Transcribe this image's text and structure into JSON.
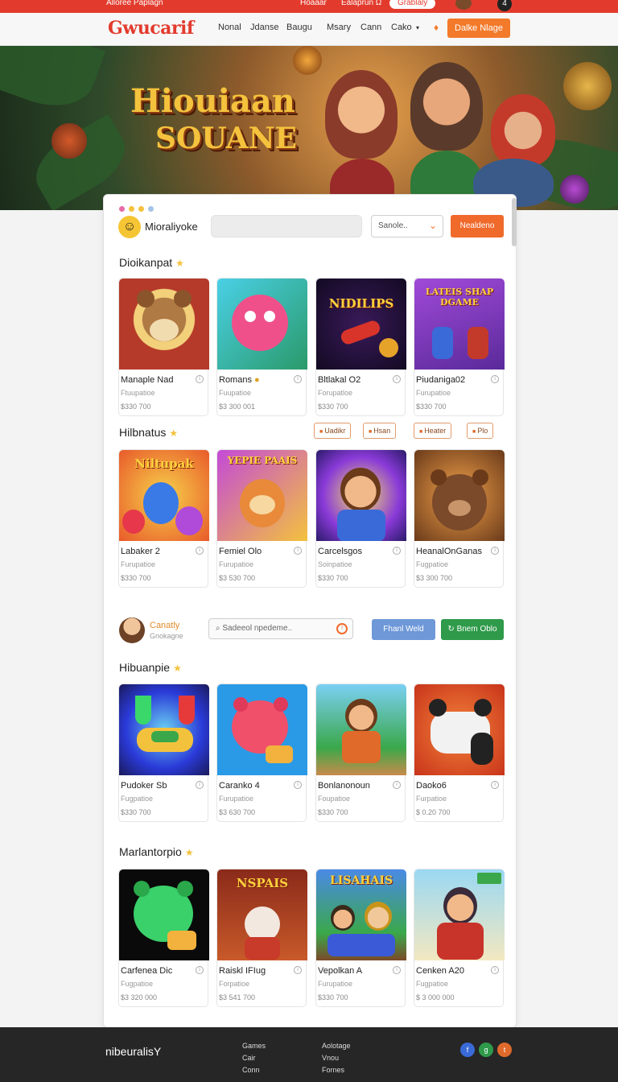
{
  "topbar": {
    "left_text": "Alloree Paplagn",
    "mid1": "Hoaaar",
    "mid2": "Ealaprun Ω",
    "pill": "Grablaly",
    "bell": "4"
  },
  "nav": {
    "logo": "Gwucarif",
    "links": [
      "Nonal",
      "Jdanse",
      "Baugu",
      "Msary",
      "Cann",
      "Cako"
    ],
    "cta": "Dalke Nlage",
    "colors": {
      "brand": "#e23b2d",
      "accent": "#f37a2b"
    }
  },
  "hero": {
    "title": "Hiouiaan",
    "subtitle": "SOUANE"
  },
  "panel": {
    "user_name": "Mioraliyoke",
    "select_value": "Sanole..",
    "button": "Nealdeno",
    "sections": [
      {
        "title": "Dioikanpat",
        "cards": [
          {
            "name": "Manaple Nad",
            "sub": "Ftuupatioe",
            "price": "$330 700",
            "thumb": "ABCDEF"
          },
          {
            "name": "Romans",
            "sub": "Fuupatioe",
            "price": "$3 300 001",
            "thumb": ""
          },
          {
            "name": "Bltlakal O2",
            "sub": "Forupatloe",
            "price": "$330 700",
            "thumb": "NIDILIPS"
          },
          {
            "name": "Piudaniga02",
            "sub": "Furupatioe",
            "price": "$330 700",
            "thumb": "LATEIS SHAP DGAME"
          }
        ]
      },
      {
        "title": "Hilbnatus",
        "tags": [
          "Uadikr",
          "Hsan",
          "Heater",
          "Plo"
        ],
        "cards": [
          {
            "name": "Labaker 2",
            "sub": "Furupatioe",
            "price": "$330 700",
            "thumb": "Niltupak"
          },
          {
            "name": "Femiel Olo",
            "sub": "Furupatioe",
            "price": "$3 530 700",
            "thumb": "YEPIE PAAIS"
          },
          {
            "name": "Carcelsgos",
            "sub": "Soinpatioe",
            "price": "$330 700",
            "thumb": ""
          },
          {
            "name": "HeanalOnGanas",
            "sub": "Fugpatioe",
            "price": "$3 300 700",
            "thumb": ""
          }
        ]
      },
      {
        "title": "Hibuanpie",
        "cards": [
          {
            "name": "Pudoker Sb",
            "sub": "Fugpatioe",
            "price": "$330 700",
            "thumb": ""
          },
          {
            "name": "Caranko 4",
            "sub": "Furupatioe",
            "price": "$3 630 700",
            "thumb": ""
          },
          {
            "name": "Bonlanonoun",
            "sub": "Foupatioe",
            "price": "$330 700",
            "thumb": ""
          },
          {
            "name": "Daoko6",
            "sub": "Furpatioe",
            "price": "$ 0.20 700",
            "thumb": ""
          }
        ]
      },
      {
        "title": "Marlantorpio",
        "cards": [
          {
            "name": "Carfenea Dic",
            "sub": "Fugpatioe",
            "price": "$3 320 000",
            "thumb": ""
          },
          {
            "name": "Raiskl IFIug",
            "sub": "Forpatioe",
            "price": "$3 541 700",
            "thumb": "NSPAIS"
          },
          {
            "name": "Vepolkan A",
            "sub": "Furupatioe",
            "price": "$330 700",
            "thumb": "LISAHAIS"
          },
          {
            "name": "Cenken A20",
            "sub": "Fugpatioe",
            "price": "$ 3 000 000",
            "thumb": ""
          }
        ]
      }
    ],
    "user2": {
      "name": "Canatly",
      "sub": "Gnokagne",
      "search_placeholder": "Sadeeol npedeme..",
      "btn_blue": "Fhanl Weld",
      "btn_green": "Bnem Oblo"
    }
  },
  "footer": {
    "logo": "nibeuralisY",
    "col1": [
      "Games",
      "Cair",
      "Conn"
    ],
    "col2": [
      "Aolotage",
      "Vnou",
      "Fornes"
    ],
    "social": [
      "f",
      "g",
      "t"
    ]
  }
}
